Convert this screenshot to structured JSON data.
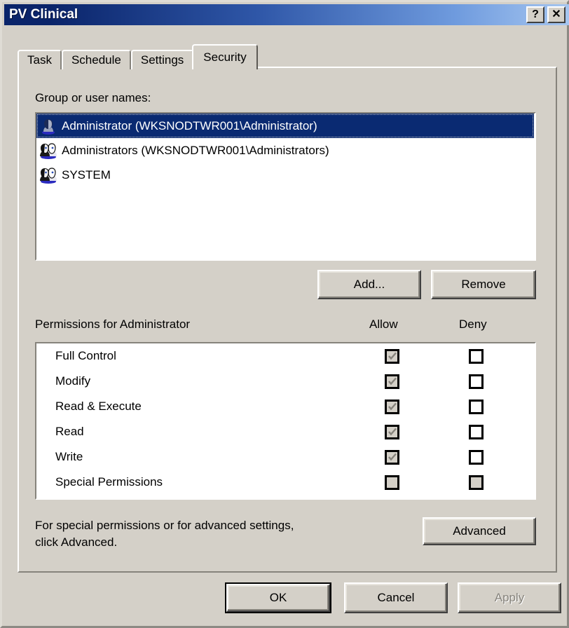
{
  "window": {
    "title": "PV Clinical",
    "help_button": "?",
    "close_button": "✕"
  },
  "tabs": [
    {
      "label": "Task",
      "active": false
    },
    {
      "label": "Schedule",
      "active": false
    },
    {
      "label": "Settings",
      "active": false
    },
    {
      "label": "Security",
      "active": true
    }
  ],
  "security": {
    "group_label": "Group or user names:",
    "entries": [
      {
        "name": "Administrator (WKSNODTWR001\\Administrator)",
        "icon": "user-icon",
        "selected": true
      },
      {
        "name": "Administrators (WKSNODTWR001\\Administrators)",
        "icon": "group-icon",
        "selected": false
      },
      {
        "name": "SYSTEM",
        "icon": "group-icon",
        "selected": false
      }
    ],
    "add_label": "Add...",
    "remove_label": "Remove",
    "permissions_label": "Permissions for Administrator",
    "column_allow": "Allow",
    "column_deny": "Deny",
    "permissions": [
      {
        "name": "Full Control",
        "allow": "checked-disabled",
        "deny": "unchecked"
      },
      {
        "name": "Modify",
        "allow": "checked-disabled",
        "deny": "unchecked"
      },
      {
        "name": "Read & Execute",
        "allow": "checked-disabled",
        "deny": "unchecked"
      },
      {
        "name": "Read",
        "allow": "checked-disabled",
        "deny": "unchecked"
      },
      {
        "name": "Write",
        "allow": "checked-disabled",
        "deny": "unchecked"
      },
      {
        "name": "Special Permissions",
        "allow": "unchecked-disabled",
        "deny": "unchecked-disabled"
      }
    ],
    "advanced_note_line1": "For special permissions or for advanced settings,",
    "advanced_note_line2": "click Advanced.",
    "advanced_label": "Advanced"
  },
  "footer": {
    "ok_label": "OK",
    "cancel_label": "Cancel",
    "apply_label": "Apply",
    "apply_disabled": true
  },
  "colors": {
    "dialog_face": "#d4d0c8",
    "title_start": "#0a246a",
    "title_end": "#a6c6f0",
    "selection": "#0a2a72",
    "disabled_text": "#86837c"
  }
}
